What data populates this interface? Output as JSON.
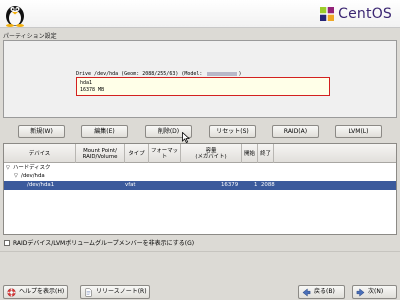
{
  "banner": {
    "brand_text": "CentOS"
  },
  "section": {
    "title": "パーティション設定"
  },
  "drive": {
    "caption": "Drive /dev/hda (Geom: 2088/255/63) (Model: ",
    "caption_close": ")",
    "partition_name": "hda1",
    "partition_size": "16378 MB"
  },
  "actions": {
    "new": "新規(W)",
    "edit": "編集(E)",
    "delete": "削除(D)",
    "reset": "リセット(S)",
    "raid": "RAID(A)",
    "lvm": "LVM(L)"
  },
  "table": {
    "headers": {
      "device": "デバイス",
      "mount": "Mount Point/\nRAID/Volume",
      "type": "タイプ",
      "format": "フォーマット",
      "size": "容量\n(メガバイト)",
      "start": "開始",
      "end": "終了"
    },
    "rows": [
      {
        "label": "ハードディスク",
        "expander": "▽"
      },
      {
        "label": "/dev/hda",
        "expander": "▽"
      },
      {
        "device": "/dev/hda1",
        "mount": "",
        "type": "vfat",
        "format": "",
        "size": "16379",
        "start": "1",
        "end": "2088",
        "selected": true
      }
    ]
  },
  "options": {
    "hide_raid_lvm": "RAIDデバイス/LVMボリュームグループメンバーを非表示にする(G)",
    "hide_raid_lvm_checked": false
  },
  "nav": {
    "help": "ヘルプを表示(H)",
    "release_notes": "リリースノート(R)",
    "back": "戻る(B)",
    "next": "次(N)"
  },
  "colors": {
    "selection": "#3b5a9c",
    "drive_border": "#d32020",
    "brand": "#3b2672"
  }
}
